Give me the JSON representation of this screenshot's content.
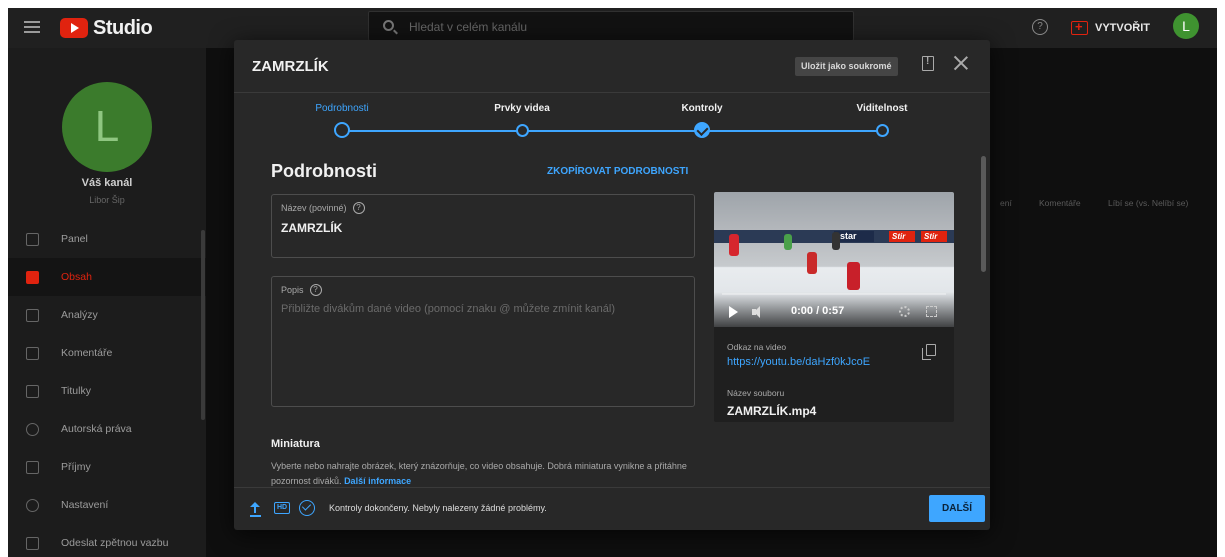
{
  "app": {
    "logo_text": "Studio",
    "search_placeholder": "Hledat v celém kanálu",
    "create_label": "VYTVOŘIT",
    "avatar_letter": "L"
  },
  "sidebar": {
    "avatar_letter": "L",
    "channel_title": "Váš kanál",
    "channel_owner": "Libor Šip",
    "items": [
      {
        "label": "Panel",
        "icon": "dashboard-icon",
        "active": false
      },
      {
        "label": "Obsah",
        "icon": "content-icon",
        "active": true
      },
      {
        "label": "Analýzy",
        "icon": "analytics-icon",
        "active": false
      },
      {
        "label": "Komentáře",
        "icon": "comments-icon",
        "active": false
      },
      {
        "label": "Titulky",
        "icon": "subtitles-icon",
        "active": false
      },
      {
        "label": "Autorská práva",
        "icon": "copyright-icon",
        "active": false
      },
      {
        "label": "Příjmy",
        "icon": "earn-icon",
        "active": false
      },
      {
        "label": "Nastavení",
        "icon": "gear-icon",
        "active": false
      },
      {
        "label": "Odeslat zpětnou vazbu",
        "icon": "feedback-icon",
        "active": false
      }
    ]
  },
  "background": {
    "columns": [
      "ení",
      "Komentáře",
      "Líbí se (vs. Nelíbí se)"
    ]
  },
  "modal": {
    "title": "ZAMRZLÍK",
    "save_private_label": "Uložit jako soukromé",
    "steps": [
      {
        "label": "Podrobnosti",
        "state": "current"
      },
      {
        "label": "Prvky videa",
        "state": "todo"
      },
      {
        "label": "Kontroly",
        "state": "done"
      },
      {
        "label": "Viditelnost",
        "state": "todo"
      }
    ],
    "section_title": "Podrobnosti",
    "copy_details_label": "ZKOPÍROVAT PODROBNOSTI",
    "name_field": {
      "label": "Název (povinné)",
      "value": "ZAMRZLÍK"
    },
    "description_field": {
      "label": "Popis",
      "placeholder": "Přibližte divákům dané video (pomocí znaku @ můžete zmínit kanál)"
    },
    "thumbnail": {
      "title": "Miniatura",
      "description": "Vyberte nebo nahrajte obrázek, který znázorňuje, co video obsahuje. Dobrá miniatura vynikne a přitáhne pozornost diváků.",
      "link": "Další informace"
    },
    "preview": {
      "time": "0:00 / 0:57",
      "video_link_label": "Odkaz na video",
      "video_link": "https://youtu.be/daHzf0kJcoE",
      "filename_label": "Název souboru",
      "filename": "ZAMRZLÍK.mp4",
      "board_ads": [
        "star",
        "Stir",
        "Stir"
      ]
    },
    "footer": {
      "status": "Kontroly dokončeny. Nebyly nalezeny žádné problémy.",
      "next_label": "DALŠÍ",
      "hd_label": "HD"
    }
  },
  "colors": {
    "accent": "#3ea6ff",
    "brand_red": "#e0230f",
    "avatar_green": "#3f9330",
    "modal_bg": "#282828",
    "app_bg": "#0f0f0f"
  }
}
